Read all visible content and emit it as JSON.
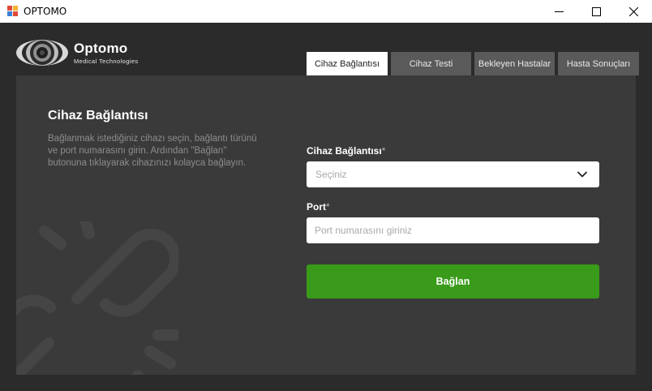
{
  "window": {
    "title": "OPTOMO",
    "icon": "app-window-icon",
    "controls": [
      "minimize-icon",
      "maximize-icon",
      "close-icon"
    ]
  },
  "brand": {
    "name": "Optomo",
    "tagline": "Medical Technologies"
  },
  "tabs": [
    {
      "label": "Cihaz Bağlantısı",
      "active": true
    },
    {
      "label": "Cihaz Testi",
      "active": false
    },
    {
      "label": "Bekleyen Hastalar",
      "active": false
    },
    {
      "label": "Hasta Sonuçları",
      "active": false
    }
  ],
  "panel": {
    "title": "Cihaz Bağlantısı",
    "description": "Bağlanmak istediğiniz cihazı seçin, bağlantı türünü ve port numarasını girin. Ardından \"Bağlan\" butonuna tıklayarak cihazınızı kolayca bağlayın.",
    "watermark_icon": "link-icon"
  },
  "form": {
    "device_label": "Cihaz Bağlantısı",
    "device_required": "*",
    "device_placeholder": "Seçiniz",
    "port_label": "Port",
    "port_required": "*",
    "port_placeholder": "Port numarasını giriniz",
    "port_value": "",
    "submit_label": "Bağlan"
  },
  "colors": {
    "background": "#2b2b2b",
    "panel": "#3a3a3a",
    "tab_inactive": "#5a5a5a",
    "accent_green": "#3a9a1a"
  }
}
